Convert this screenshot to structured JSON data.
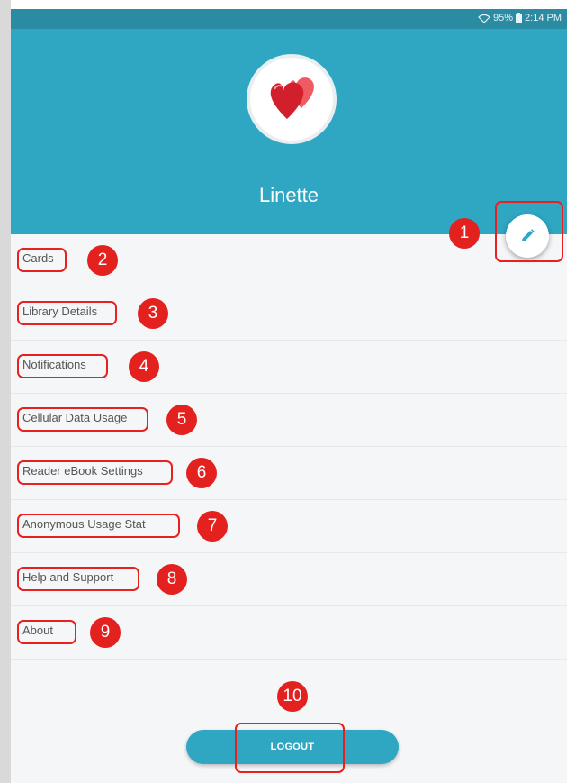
{
  "status_bar": {
    "battery": "95%",
    "time": "2:14 PM"
  },
  "profile": {
    "name": "Linette"
  },
  "menu": [
    {
      "label": "Cards",
      "marker": "2"
    },
    {
      "label": "Library Details",
      "marker": "3"
    },
    {
      "label": "Notifications",
      "marker": "4"
    },
    {
      "label": "Cellular Data Usage",
      "marker": "5"
    },
    {
      "label": "Reader eBook Settings",
      "marker": "6"
    },
    {
      "label": "Anonymous Usage Stat",
      "marker": "7"
    },
    {
      "label": "Help and Support",
      "marker": "8"
    },
    {
      "label": "About",
      "marker": "9"
    }
  ],
  "edit_marker": "1",
  "logout": {
    "label": "LOGOUT",
    "marker": "10"
  },
  "colors": {
    "header": "#2fa7c2",
    "status_bar": "#2a8ba3",
    "highlight": "#e8201f"
  },
  "icons": {
    "edit": "pencil-icon",
    "avatar": "hearts-icon",
    "wifi": "wifi-icon",
    "battery": "battery-icon"
  }
}
